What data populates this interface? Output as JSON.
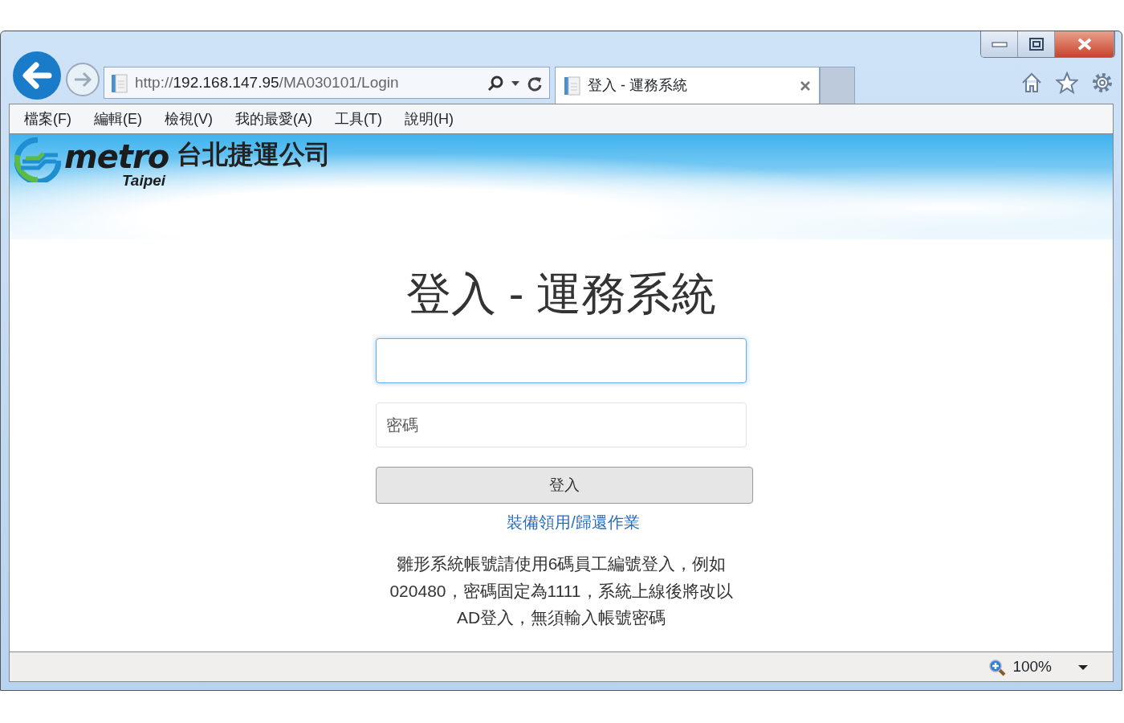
{
  "address_bar": {
    "scheme": "http://",
    "host": "192.168.147.95",
    "path": "/MA030101/Login"
  },
  "tabs": [
    {
      "label": "登入 - 運務系統",
      "selected": true
    }
  ],
  "menu": [
    "檔案(F)",
    "編輯(E)",
    "檢視(V)",
    "我的最愛(A)",
    "工具(T)",
    "說明(H)"
  ],
  "header": {
    "logo_word": "metro",
    "logo_city": "Taipei",
    "company": "台北捷運公司"
  },
  "login": {
    "title": "登入 - 運務系統",
    "username": {
      "focused": true
    },
    "password": {
      "placeholder": "密碼",
      "focused": false
    },
    "button": "登入",
    "link": "裝備領用/歸還作業",
    "note_lines": [
      "雛形系統帳號請使用6碼員工編號登入，例如",
      "020480，密碼固定為1111，系統上線後將改以",
      "AD登入，無須輸入帳號密碼"
    ]
  },
  "status_bar": {
    "zoom": "100%"
  }
}
